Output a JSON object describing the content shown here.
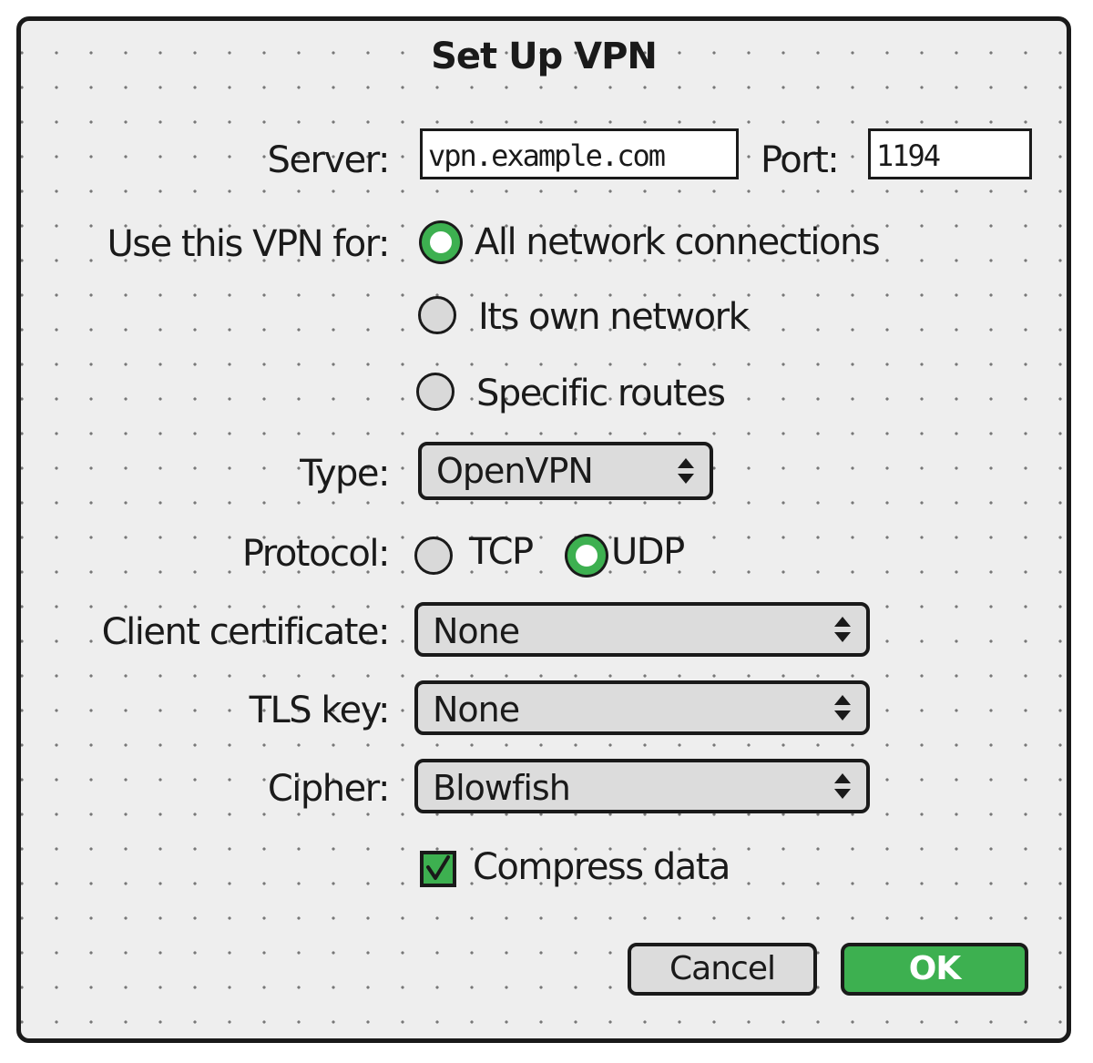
{
  "dialog": {
    "title": "Set Up VPN"
  },
  "server": {
    "label": "Server:",
    "value": "vpn.example.com",
    "port_label": "Port:",
    "port_value": "1194"
  },
  "use_for": {
    "label": "Use this VPN for:",
    "options": [
      {
        "label": "All network connections",
        "selected": true
      },
      {
        "label": "Its own network",
        "selected": false
      },
      {
        "label": "Specific routes",
        "selected": false
      }
    ]
  },
  "type": {
    "label": "Type:",
    "value": "OpenVPN"
  },
  "protocol": {
    "label": "Protocol:",
    "options": [
      {
        "label": "TCP",
        "selected": false
      },
      {
        "label": "UDP",
        "selected": true
      }
    ]
  },
  "client_certificate": {
    "label": "Client certificate:",
    "value": "None"
  },
  "tls_key": {
    "label": "TLS key:",
    "value": "None"
  },
  "cipher": {
    "label": "Cipher:",
    "value": "Blowfish"
  },
  "compress": {
    "label": "Compress data",
    "checked": true
  },
  "buttons": {
    "cancel_label": "Cancel",
    "ok_label": "OK"
  },
  "colors": {
    "accent": "#3db050",
    "dialog_background": "#eeeeee",
    "field_background": "#dcdcdc",
    "stroke": "#1a1a1a"
  }
}
